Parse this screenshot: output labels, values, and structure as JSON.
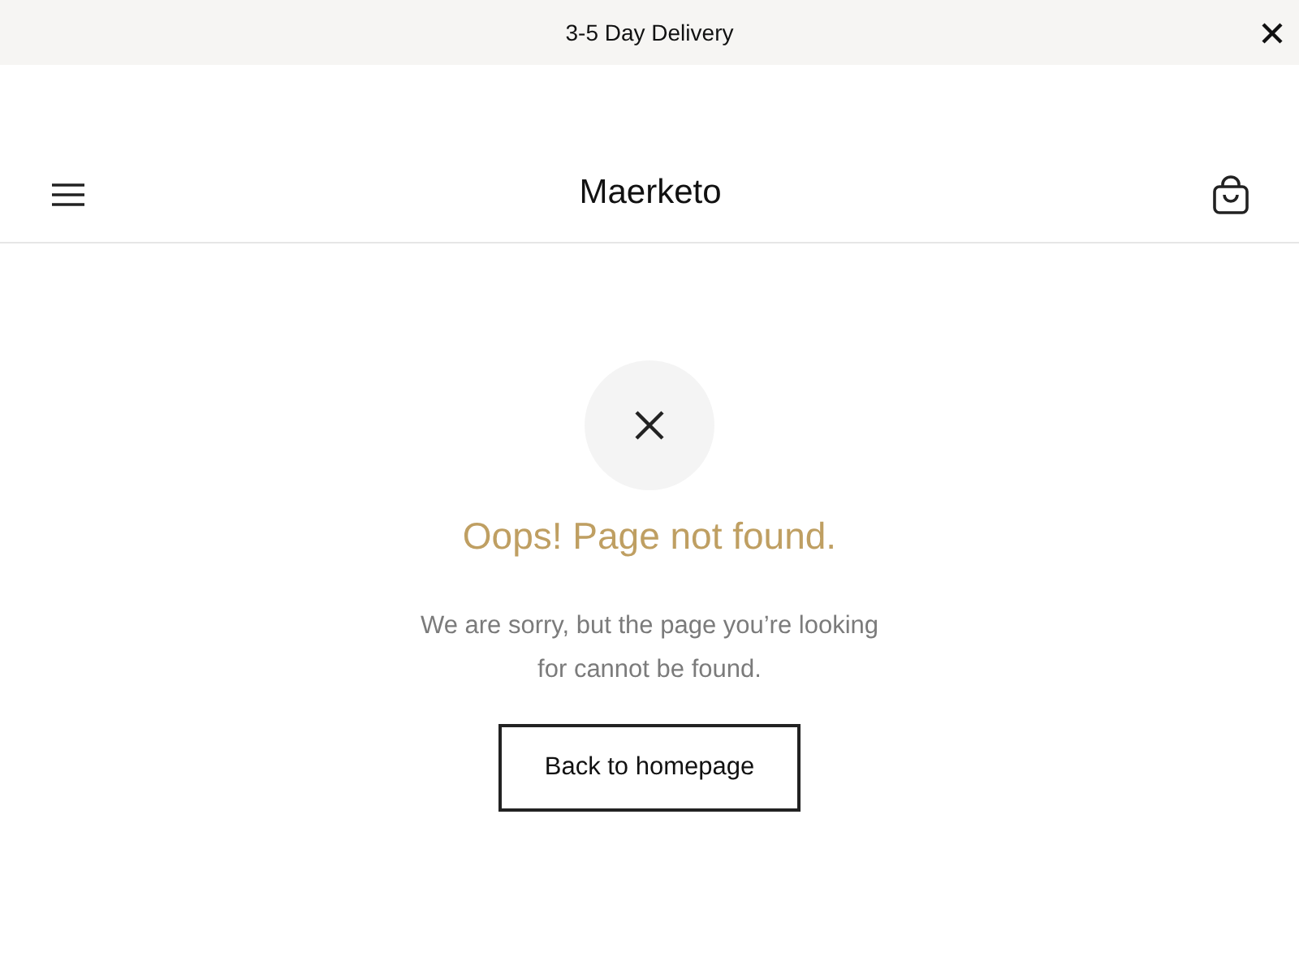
{
  "announcement": {
    "text": "3-5 Day Delivery"
  },
  "header": {
    "logo": "Maerketo"
  },
  "error": {
    "title": "Oops! Page not found.",
    "message": "We are sorry, but the page you’re looking for cannot be found.",
    "button": "Back to homepage"
  }
}
